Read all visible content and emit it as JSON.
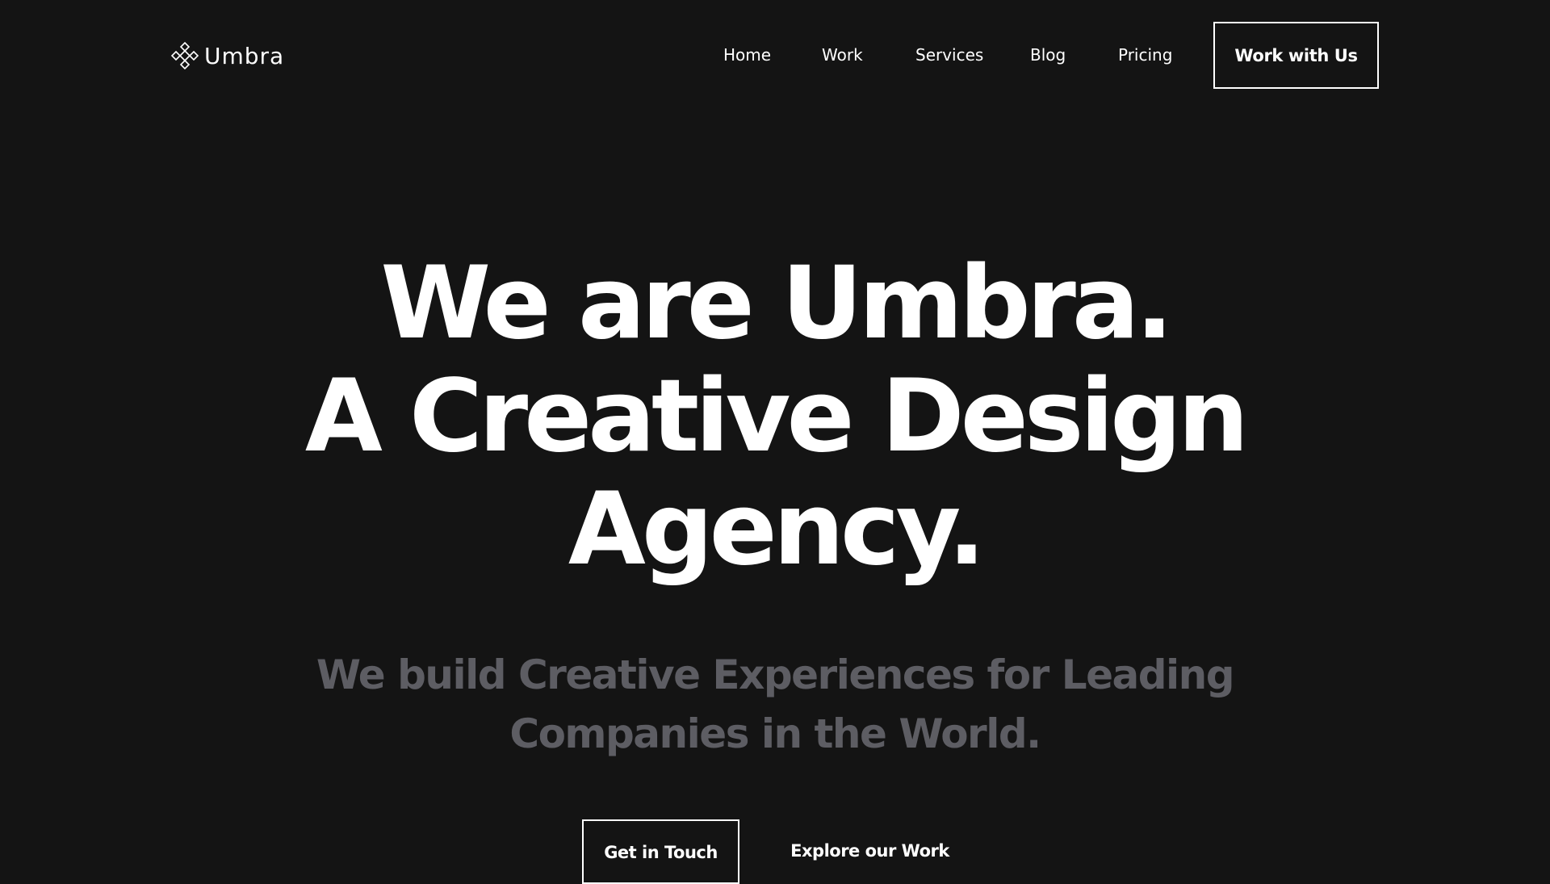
{
  "brand": {
    "name": "Umbra",
    "logo_icon": "diamond-cluster-icon"
  },
  "nav": {
    "items": [
      {
        "label": "Home"
      },
      {
        "label": "Work"
      },
      {
        "label": "Services"
      },
      {
        "label": "Blog"
      },
      {
        "label": "Pricing"
      }
    ],
    "cta_label": "Work with Us"
  },
  "hero": {
    "title_lines": [
      "We are Umbra.",
      "A Creative Design",
      "Agency."
    ],
    "subtitle_lines": [
      "We build Creative Experiences for Leading",
      "Companies in the World."
    ],
    "primary_button": "Get in Touch",
    "secondary_button": "Explore our Work"
  },
  "colors": {
    "background": "#141414",
    "text": "#ffffff",
    "subtitle": "#5d5d63"
  }
}
